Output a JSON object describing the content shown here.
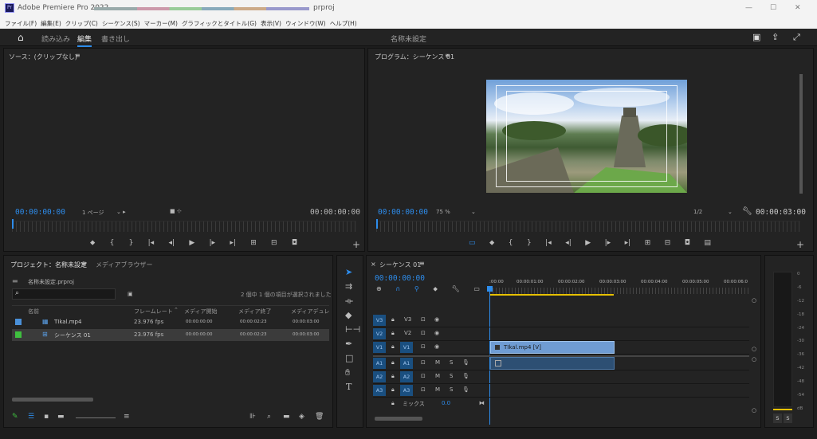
{
  "window": {
    "app_title": "Adobe Premiere Pro 2022 -",
    "file_suffix": "prproj",
    "min": "—",
    "max": "☐",
    "close": "✕"
  },
  "menu": [
    "ファイル(F)",
    "編集(E)",
    "クリップ(C)",
    "シーケンス(S)",
    "マーカー(M)",
    "グラフィックとタイトル(G)",
    "表示(V)",
    "ウィンドウ(W)",
    "ヘルプ(H)"
  ],
  "workspace": {
    "tabs": [
      "読み込み",
      "編集",
      "書き出し"
    ],
    "active": "編集",
    "center_title": "名称未設定"
  },
  "source": {
    "title": "ソース：(クリップなし)",
    "timecode_left": "00:00:00:00",
    "page": "1 ページ",
    "timecode_right": "00:00:00:00"
  },
  "program": {
    "title": "プログラム：シーケンス 01",
    "timecode_left": "00:00:00:00",
    "zoom": "75 %",
    "resolution": "1/2",
    "timecode_right": "00:00:03:00"
  },
  "project": {
    "tabs": [
      "プロジェクト：名称未設定",
      "メディアブラウザー"
    ],
    "file": "名称未設定.prproj",
    "status": "2 個中 1 個の項目が選択されました",
    "columns": [
      "名前",
      "フレームレート",
      "メディア開始",
      "メディア終了",
      "メディアデュレ"
    ],
    "rows": [
      {
        "name": "TIkal.mp4",
        "fps": "23.976 fps",
        "start": "00:00:00:00",
        "end": "00:00:02:23",
        "dur": "00:00:03:00",
        "color": "#4a90d9"
      },
      {
        "name": "シーケンス 01",
        "fps": "23.976 fps",
        "start": "00:00:00:00",
        "end": "00:00:02:23",
        "dur": "00:00:03:00",
        "color": "#3fbf3f"
      }
    ]
  },
  "timeline": {
    "tab": "シーケンス 01",
    "timecode": "00:00:00:00",
    "ruler": [
      ":00:00",
      "00:00:01:00",
      "00:00:02:00",
      "00:00:03:00",
      "00:00:04:00",
      "00:00:05:00",
      "00:00:06:0"
    ],
    "video_tracks": [
      "V3",
      "V2",
      "V1"
    ],
    "audio_tracks": [
      "A1",
      "A2",
      "A3"
    ],
    "clip_label": "TIkal.mp4 [V]",
    "mix_label": "ミックス",
    "mix_value": "0.0",
    "lock": "🔒",
    "eye": "◉",
    "m": "M",
    "s": "S",
    "mic": "🎤"
  },
  "meter": {
    "scale": [
      "0",
      "-6",
      "-12",
      "-18",
      "-24",
      "-30",
      "-36",
      "-42",
      "-48",
      "-54",
      "dB"
    ],
    "solo": "S"
  }
}
